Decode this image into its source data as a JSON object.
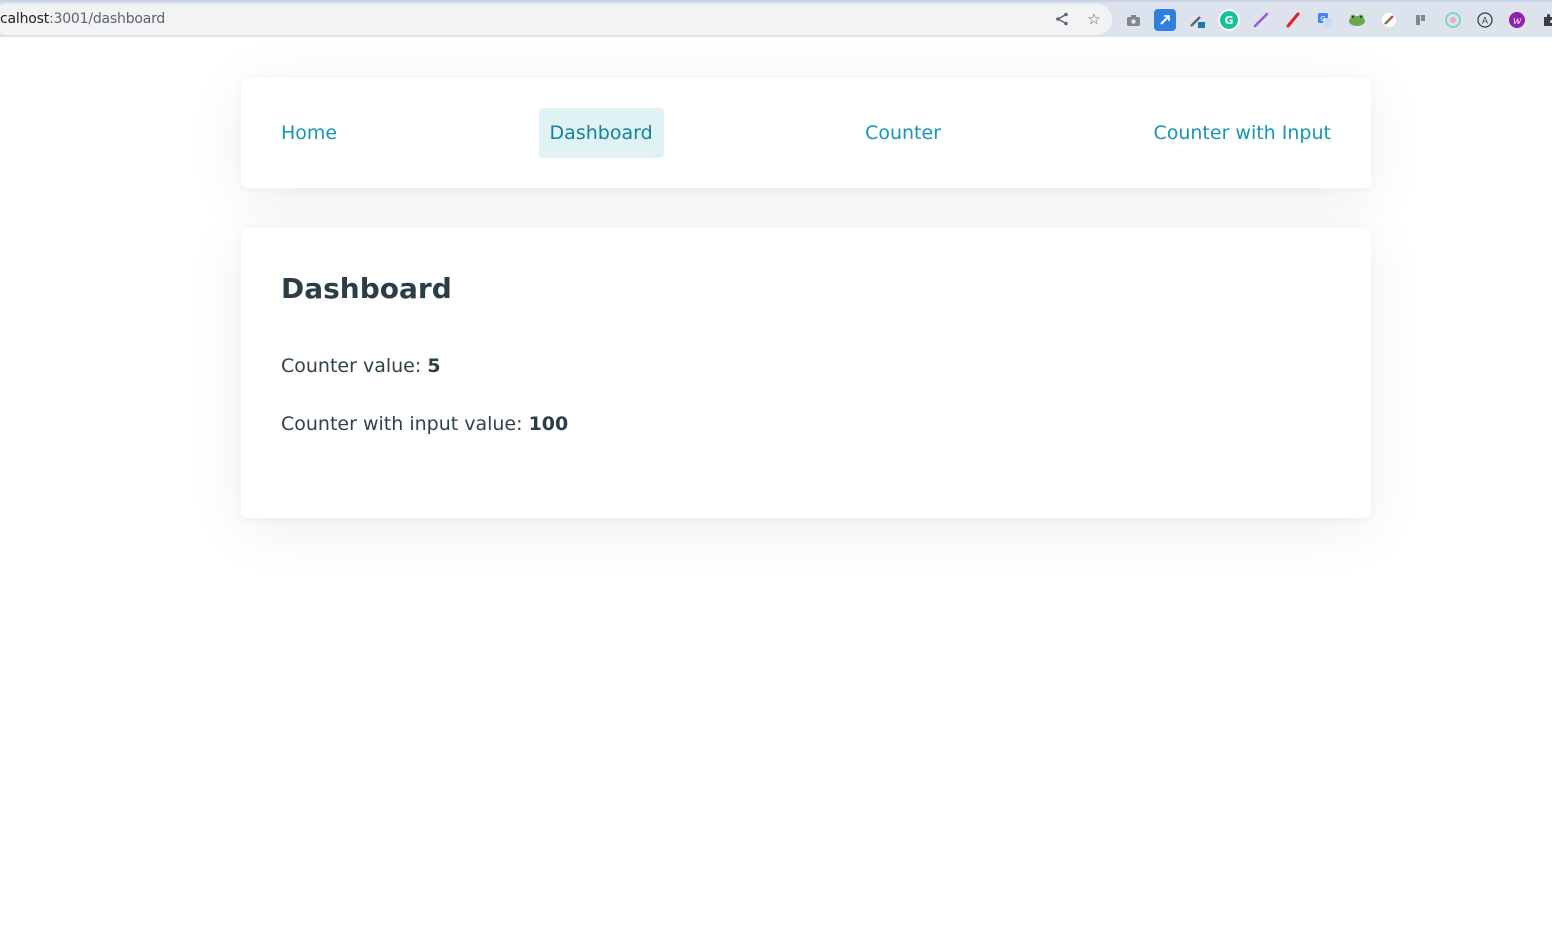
{
  "browser": {
    "url_host": "calhost",
    "url_rest": ":3001/dashboard"
  },
  "nav": {
    "items": [
      {
        "label": "Home"
      },
      {
        "label": "Dashboard",
        "active": true
      },
      {
        "label": "Counter"
      },
      {
        "label": "Counter with Input"
      }
    ]
  },
  "dashboard": {
    "title": "Dashboard",
    "counter_label": "Counter value:",
    "counter_value": "5",
    "counter_input_label": "Counter with input value:",
    "counter_input_value": "100"
  },
  "colors": {
    "link": "#1795b5",
    "active_bg": "#e1f2f5",
    "text": "#2c3e45"
  }
}
